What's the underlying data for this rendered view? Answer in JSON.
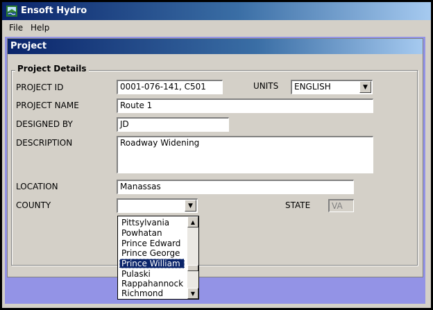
{
  "app": {
    "title": "Ensoft Hydro",
    "icon": "app-icon"
  },
  "menu": [
    {
      "label": "File"
    },
    {
      "label": "Help"
    }
  ],
  "child_window": {
    "title": "Project"
  },
  "group": {
    "label": "Project Details"
  },
  "fields": {
    "project_id": {
      "label": "PROJECT ID",
      "value": "0001-076-141, C501"
    },
    "units": {
      "label": "UNITS",
      "value": "ENGLISH"
    },
    "project_name": {
      "label": "PROJECT NAME",
      "value": "Route 1"
    },
    "designed_by": {
      "label": "DESIGNED BY",
      "value": "JD"
    },
    "description": {
      "label": "DESCRIPTION",
      "value": "Roadway Widening"
    },
    "location": {
      "label": "LOCATION",
      "value": "Manassas"
    },
    "county": {
      "label": "COUNTY",
      "value": ""
    },
    "state": {
      "label": "STATE",
      "value": "VA"
    }
  },
  "county_list": {
    "items": [
      "Pittsylvania",
      "Powhatan",
      "Prince Edward",
      "Prince George",
      "Prince William",
      "Pulaski",
      "Rappahannock",
      "Richmond"
    ],
    "selected": "Prince William"
  },
  "colors": {
    "titlebar": "#0a246a",
    "mdi_background": "#9393e6",
    "face": "#d4d0c8",
    "selection": "#0a246a"
  }
}
